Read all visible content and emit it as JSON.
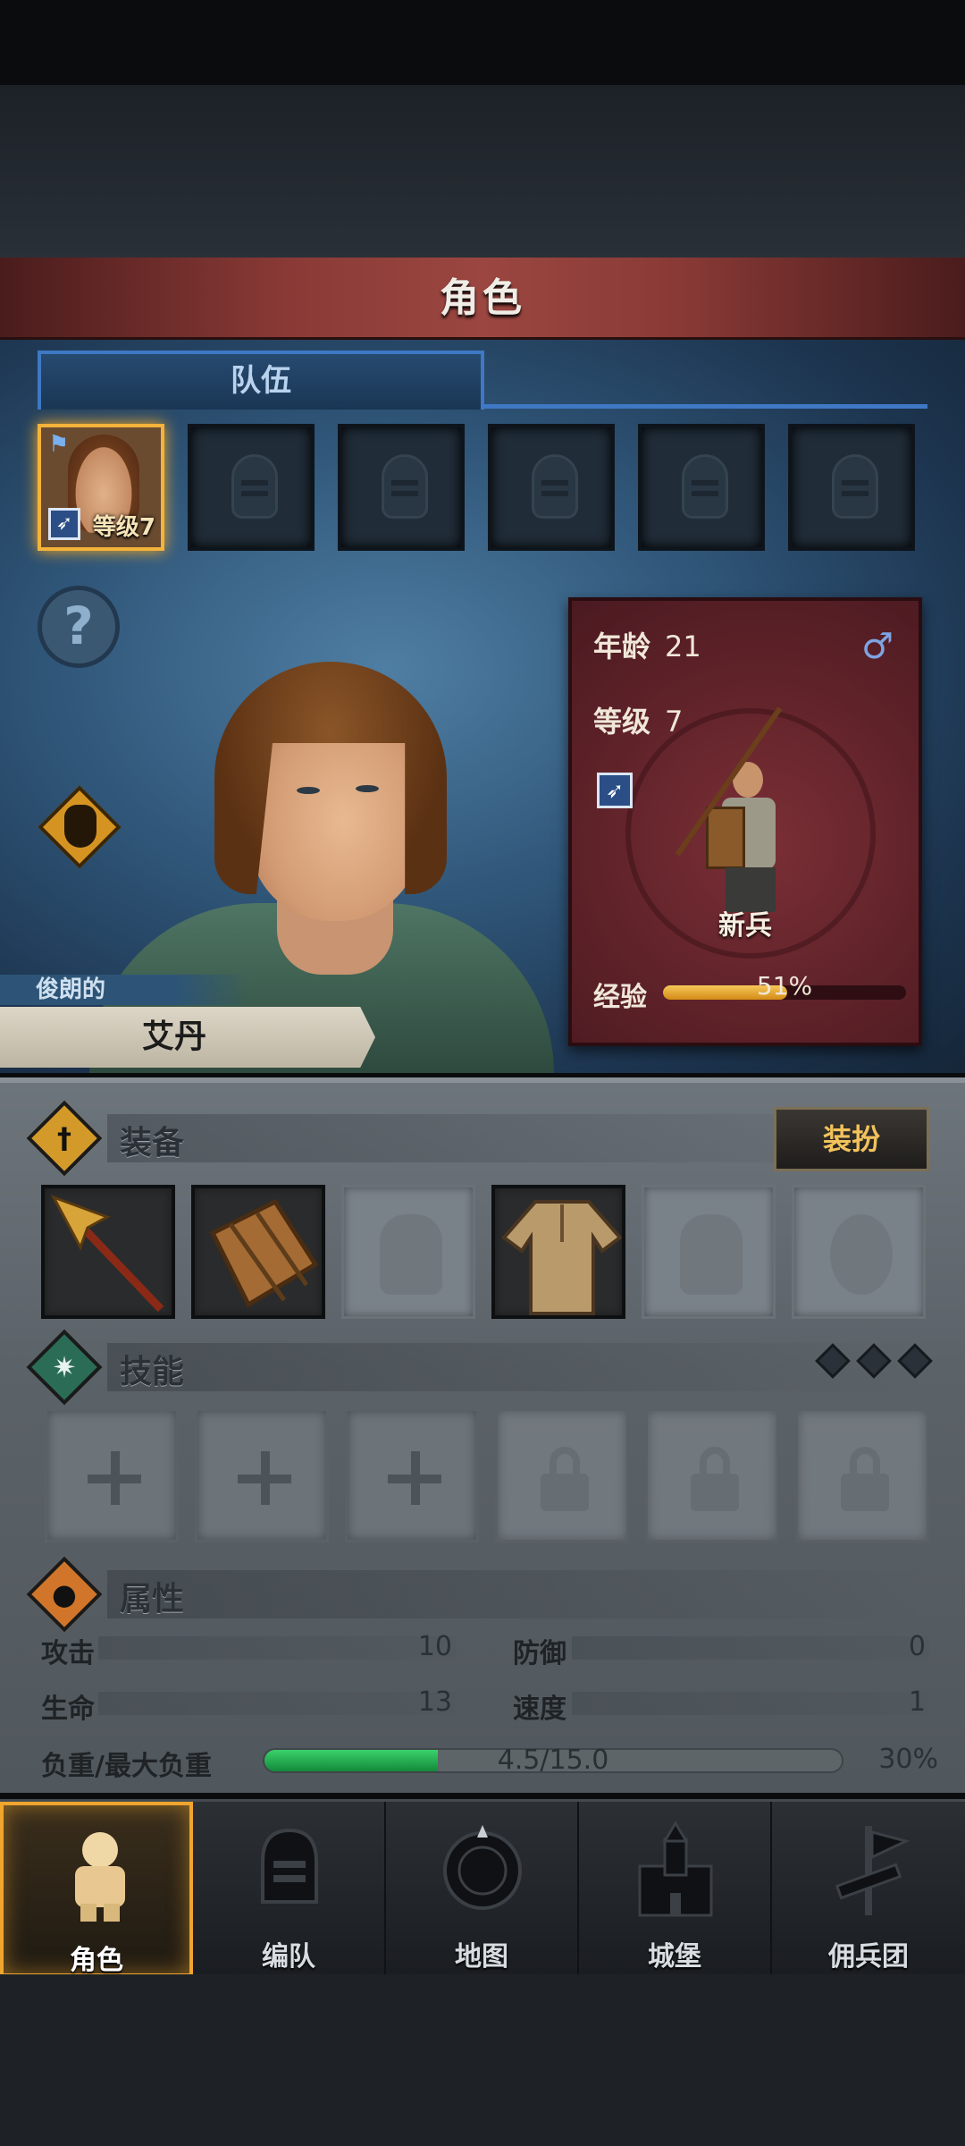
{
  "header": {
    "title": "角色"
  },
  "tabs": [
    {
      "label": "队伍",
      "active": true
    }
  ],
  "team": {
    "active_member": {
      "level_text": "等级7",
      "flag_icon": "flag-icon",
      "weapon_icon": "spear-icon"
    },
    "empty_slots": 5
  },
  "character": {
    "epithet": "俊朗的",
    "name": "艾丹",
    "age_label": "年龄",
    "age": "21",
    "gender_icon": "male-icon",
    "level_label": "等级",
    "level": "7",
    "class_name": "新兵",
    "exp_label": "经验",
    "exp_percent_text": "51%",
    "exp_fraction": 0.51
  },
  "equipment": {
    "title": "装备",
    "dress_button": "装扮",
    "slots": [
      "spear",
      "wooden-shield",
      "helmet-empty",
      "tunic",
      "boots-empty",
      "ring-empty"
    ]
  },
  "skills": {
    "title": "技能",
    "slots": [
      "unlocked",
      "unlocked",
      "unlocked",
      "locked",
      "locked",
      "locked"
    ]
  },
  "attributes": {
    "title": "属性",
    "attack_label": "攻击",
    "attack": "10",
    "defense_label": "防御",
    "defense": "0",
    "hp_label": "生命",
    "hp": "13",
    "speed_label": "速度",
    "speed": "1",
    "load_label": "负重/最大负重",
    "load_text": "4.5/15.0",
    "load_percent_text": "30%",
    "load_fraction": 0.3
  },
  "nav": [
    {
      "label": "角色",
      "icon": "knight-icon",
      "active": true
    },
    {
      "label": "编队",
      "icon": "helmet-icon",
      "active": false
    },
    {
      "label": "地图",
      "icon": "compass-map-icon",
      "active": false
    },
    {
      "label": "城堡",
      "icon": "castle-icon",
      "active": false
    },
    {
      "label": "佣兵团",
      "icon": "banner-icon",
      "active": false
    }
  ],
  "colors": {
    "accent_gold": "#f4b33a",
    "tab_blue": "#3f78c4",
    "exp_bar": "#e6a838",
    "load_bar": "#2fbf5f"
  }
}
